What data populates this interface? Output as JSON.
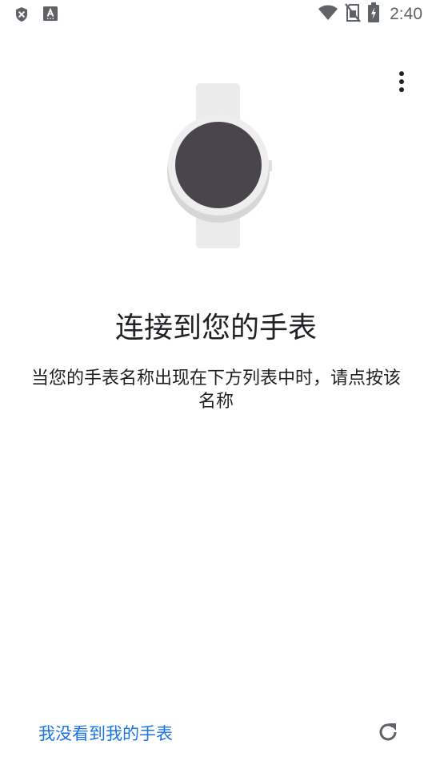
{
  "status_bar": {
    "time": "2:40",
    "left_icons": [
      "shield-x-icon",
      "keyboard-a-icon"
    ],
    "right_icons": [
      "wifi-icon",
      "no-sim-icon",
      "battery-charging-icon"
    ]
  },
  "toolbar": {
    "overflow_icon": "more-vert-icon"
  },
  "illustration": {
    "icon": "smartwatch-icon",
    "face_color": "#4a454c",
    "band_color": "#ebebeb"
  },
  "main": {
    "title": "连接到您的手表",
    "description": "当您的手表名称出现在下方列表中时，请点按该名称"
  },
  "footer": {
    "link_label": "我没看到我的手表",
    "refresh_icon": "refresh-icon"
  },
  "colors": {
    "accent": "#1a73e8",
    "icon_gray": "#5f6368",
    "text": "#202124"
  }
}
